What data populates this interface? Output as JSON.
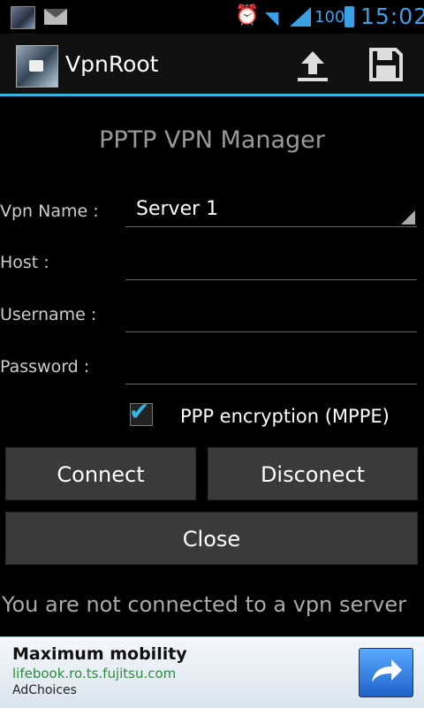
{
  "status_bar": {
    "battery": "100",
    "time": "15:02"
  },
  "action_bar": {
    "title": "VpnRoot"
  },
  "main": {
    "heading": "PPTP VPN Manager",
    "vpn_name_label": "Vpn Name :",
    "vpn_name_value": "Server 1",
    "host_label": "Host :",
    "host_value": "",
    "username_label": "Username :",
    "username_value": "",
    "password_label": "Password :",
    "password_value": "",
    "encryption_label": "PPP encryption (MPPE)",
    "encryption_checked": true,
    "connect_label": "Connect",
    "disconnect_label": "Disconect",
    "close_label": "Close",
    "status_message": "You are not connected to a vpn server"
  },
  "ad": {
    "title": "Maximum mobility",
    "url": "lifebook.ro.ts.fujitsu.com",
    "choices": "AdChoices"
  },
  "colors": {
    "accent": "#33b5e5",
    "button": "#3a3a3a",
    "ad_url": "#2e8b3a"
  }
}
